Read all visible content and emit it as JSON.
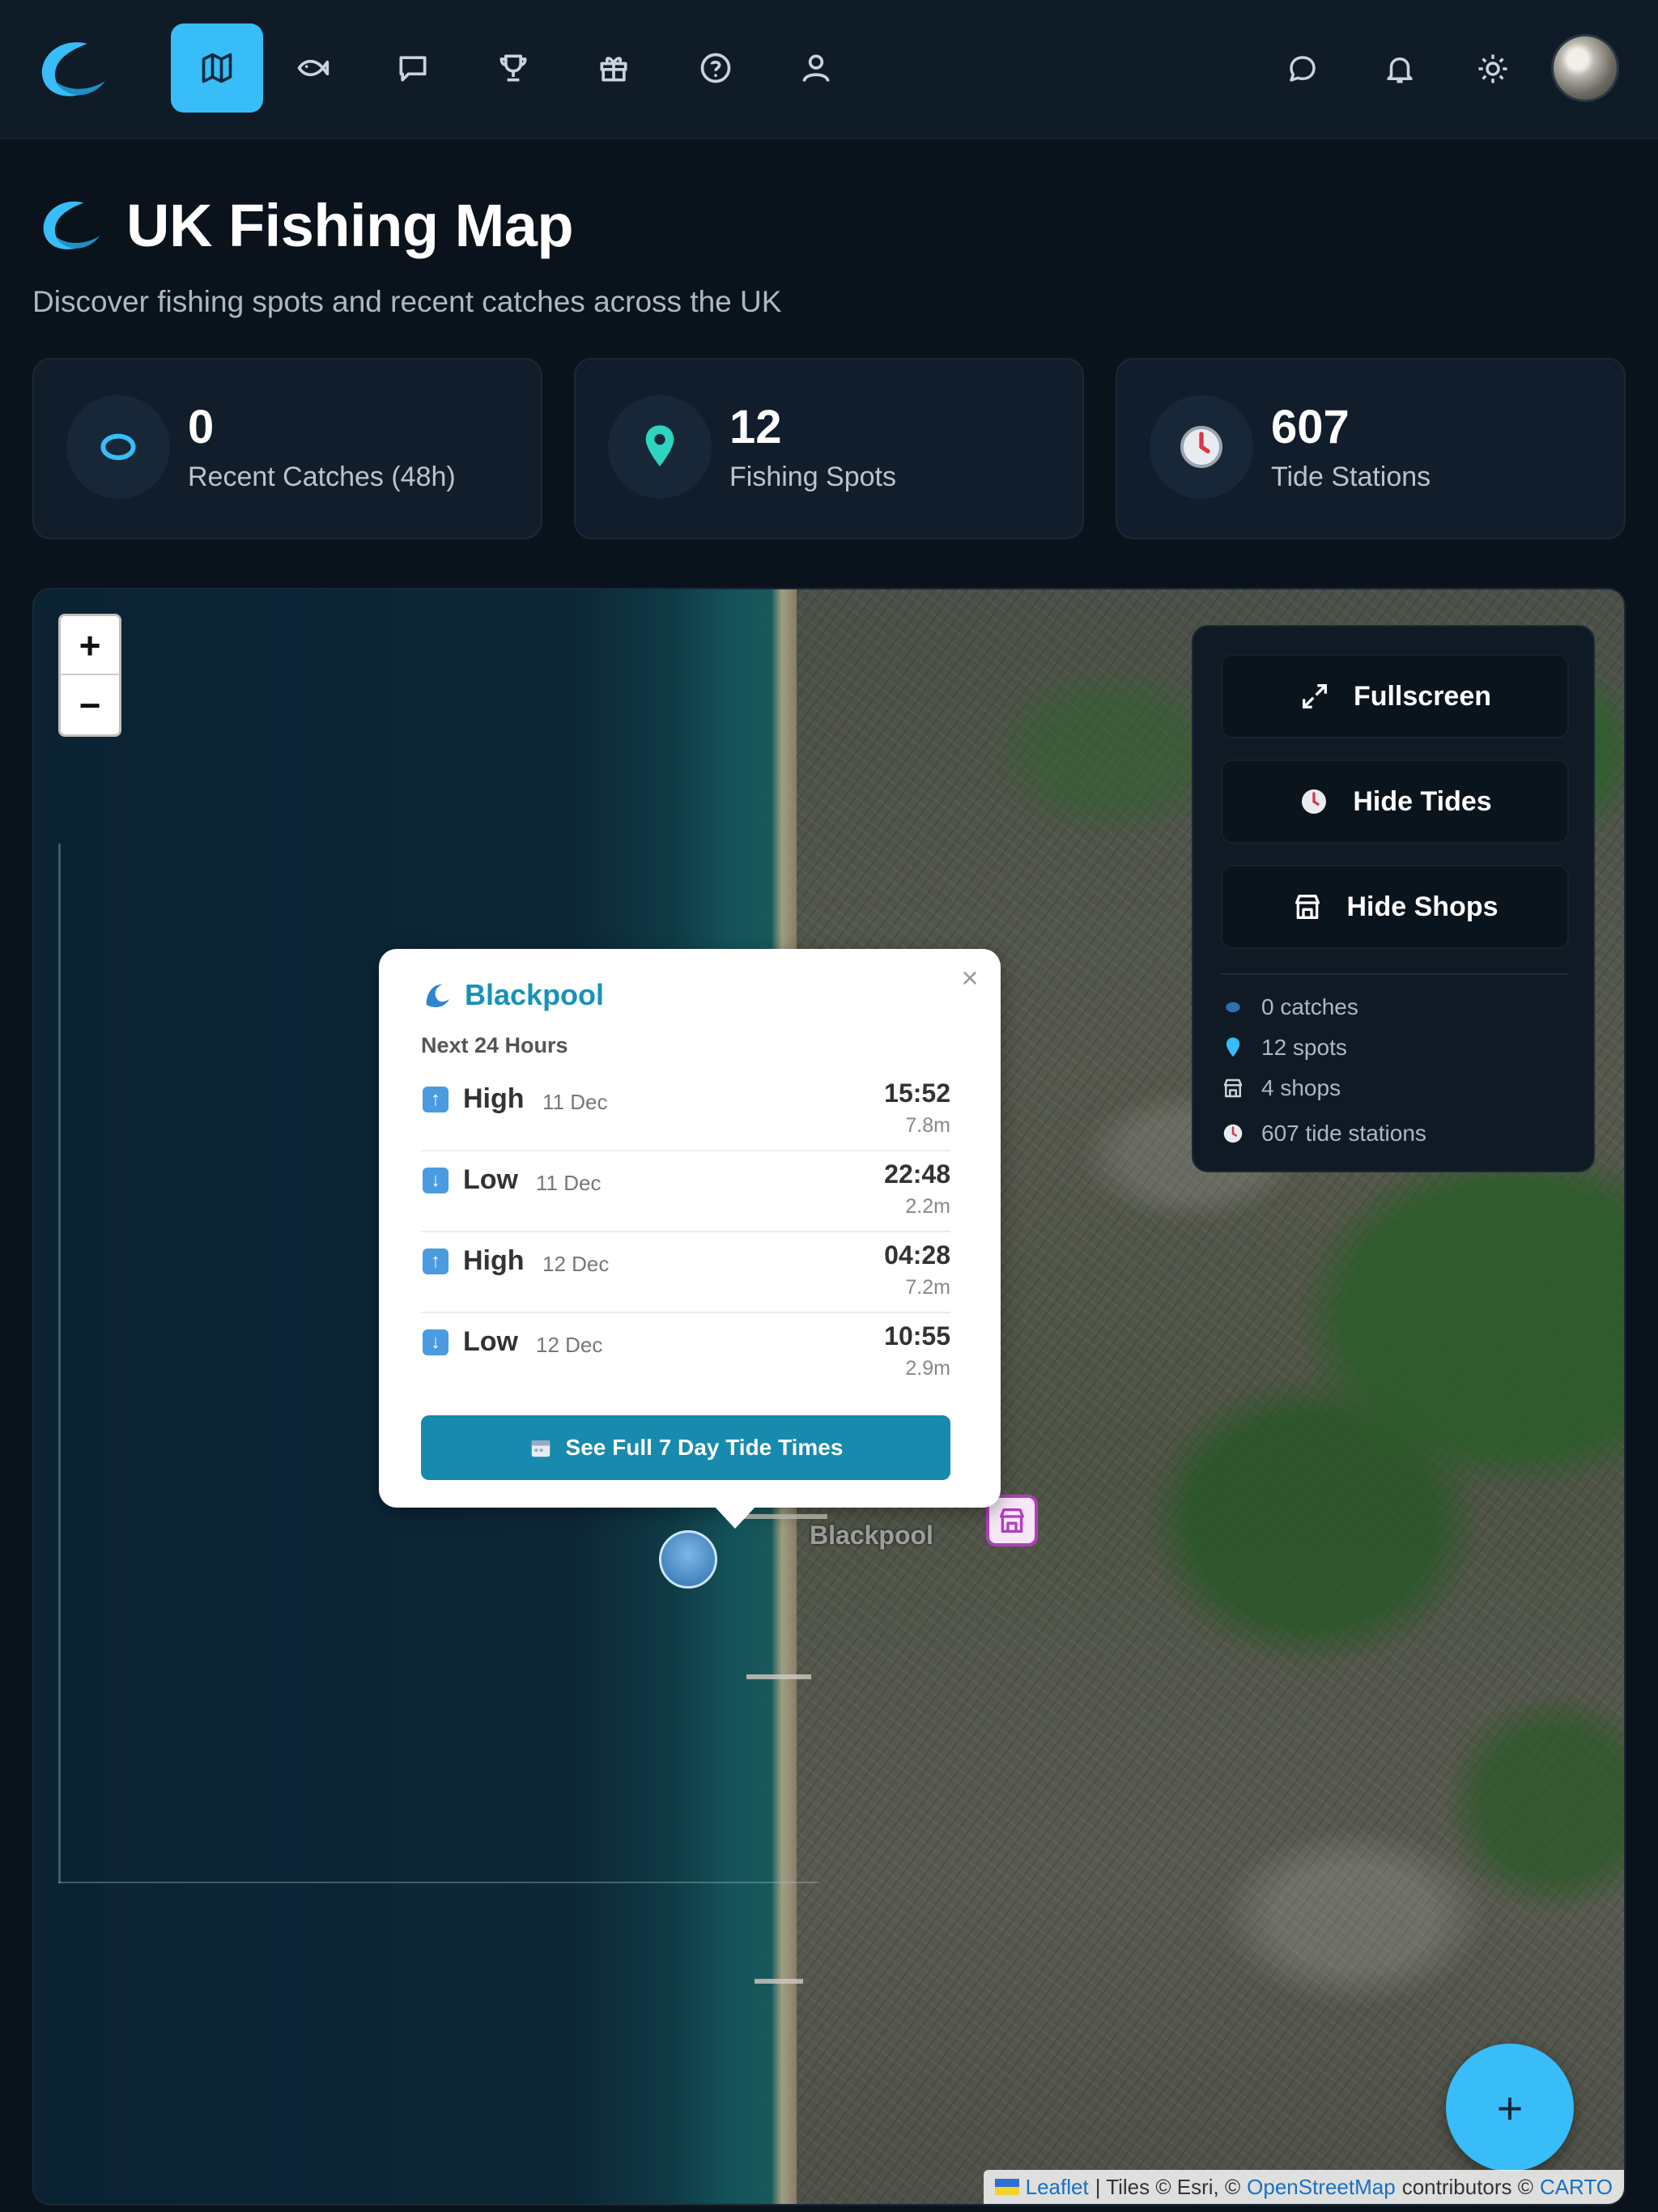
{
  "nav": {
    "items": [
      {
        "icon": "map-icon",
        "active": true
      },
      {
        "icon": "fish-icon",
        "active": false
      },
      {
        "icon": "chat-icon",
        "active": false
      },
      {
        "icon": "trophy-icon",
        "active": false
      },
      {
        "icon": "gift-icon",
        "active": false
      },
      {
        "icon": "help-icon",
        "active": false
      },
      {
        "icon": "profile-icon",
        "active": false
      }
    ],
    "right": [
      "messages-icon",
      "bell-icon",
      "sun-icon",
      "avatar"
    ],
    "accent": "#38bdf8"
  },
  "header": {
    "title": "UK Fishing Map",
    "subtitle": "Discover fishing spots and recent catches across the UK"
  },
  "stats": [
    {
      "value": "0",
      "label": "Recent Catches (48h)",
      "icon": "fish-icon"
    },
    {
      "value": "12",
      "label": "Fishing Spots",
      "icon": "location-pin-icon"
    },
    {
      "value": "607",
      "label": "Tide Stations",
      "icon": "tide-clock-icon"
    }
  ],
  "map": {
    "zoom_in": "+",
    "zoom_out": "−",
    "place_label": "Blackpool",
    "controls": {
      "fullscreen": "Fullscreen",
      "hide_tides": "Hide Tides",
      "hide_shops": "Hide Shops"
    },
    "legend": {
      "catches": "0 catches",
      "spots": "12 spots",
      "shops": "4 shops",
      "tide_stations": "607 tide stations"
    },
    "popup": {
      "close": "×",
      "title": "Blackpool",
      "subtitle": "Next 24 Hours",
      "tides": [
        {
          "type": "High",
          "date": "11 Dec",
          "time": "15:52",
          "height": "7.8m",
          "direction": "up"
        },
        {
          "type": "Low",
          "date": "11 Dec",
          "time": "22:48",
          "height": "2.2m",
          "direction": "down"
        },
        {
          "type": "High",
          "date": "12 Dec",
          "time": "04:28",
          "height": "7.2m",
          "direction": "up"
        },
        {
          "type": "Low",
          "date": "12 Dec",
          "time": "10:55",
          "height": "2.9m",
          "direction": "down"
        }
      ],
      "cta": "See Full 7 Day Tide Times"
    },
    "fab": "+",
    "attribution": {
      "leaflet": "Leaflet",
      "tiles": "| Tiles © Esri, ©",
      "osm": "OpenStreetMap",
      "contributors": "contributors ©",
      "carto": "CARTO"
    }
  }
}
